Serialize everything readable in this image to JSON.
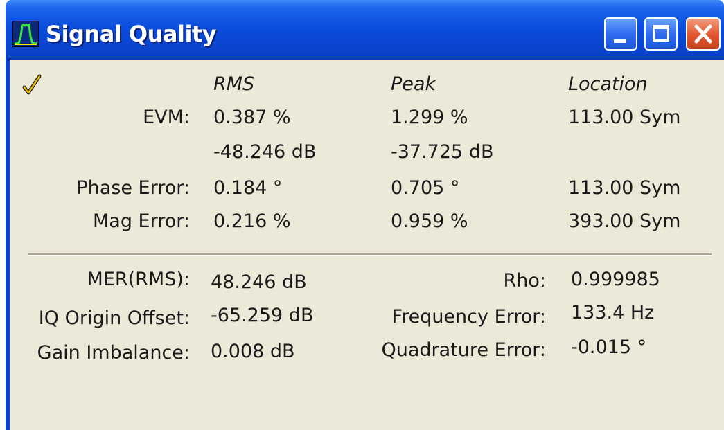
{
  "window": {
    "title": "Signal Quality"
  },
  "table": {
    "headers": {
      "rms": "RMS",
      "peak": "Peak",
      "location": "Location"
    },
    "evm": {
      "label": "EVM:",
      "rms": "0.387 %",
      "peak": "1.299 %",
      "location": "113.00 Sym"
    },
    "evm_db": {
      "rms": "-48.246 dB",
      "peak": "-37.725 dB"
    },
    "phase_error": {
      "label": "Phase Error:",
      "rms": "0.184 °",
      "peak": "0.705 °",
      "location": "113.00 Sym"
    },
    "mag_error": {
      "label": "Mag Error:",
      "rms": "0.216 %",
      "peak": "0.959 %",
      "location": "393.00 Sym"
    }
  },
  "summary": {
    "mer": {
      "label": "MER(RMS):",
      "value": "48.246 dB"
    },
    "iq_origin_offset": {
      "label": "IQ Origin Offset:",
      "value": "-65.259 dB"
    },
    "gain_imbalance": {
      "label": "Gain Imbalance:",
      "value": "0.008 dB"
    },
    "rho": {
      "label": "Rho:",
      "value": "0.999985"
    },
    "frequency_error": {
      "label": "Frequency Error:",
      "value": "133.4 Hz"
    },
    "quadrature_error": {
      "label": "Quadrature Error:",
      "value": "-0.015 °"
    }
  },
  "icons": {
    "app": "spectrum-icon",
    "status": "checkmark-icon",
    "minimize": "minimize-icon",
    "maximize": "maximize-icon",
    "close": "close-icon"
  },
  "colors": {
    "titlebar": "#0a46d2",
    "client_bg": "#ece9d8",
    "checkmark": "#e8b800",
    "close_button": "#e0552e"
  }
}
